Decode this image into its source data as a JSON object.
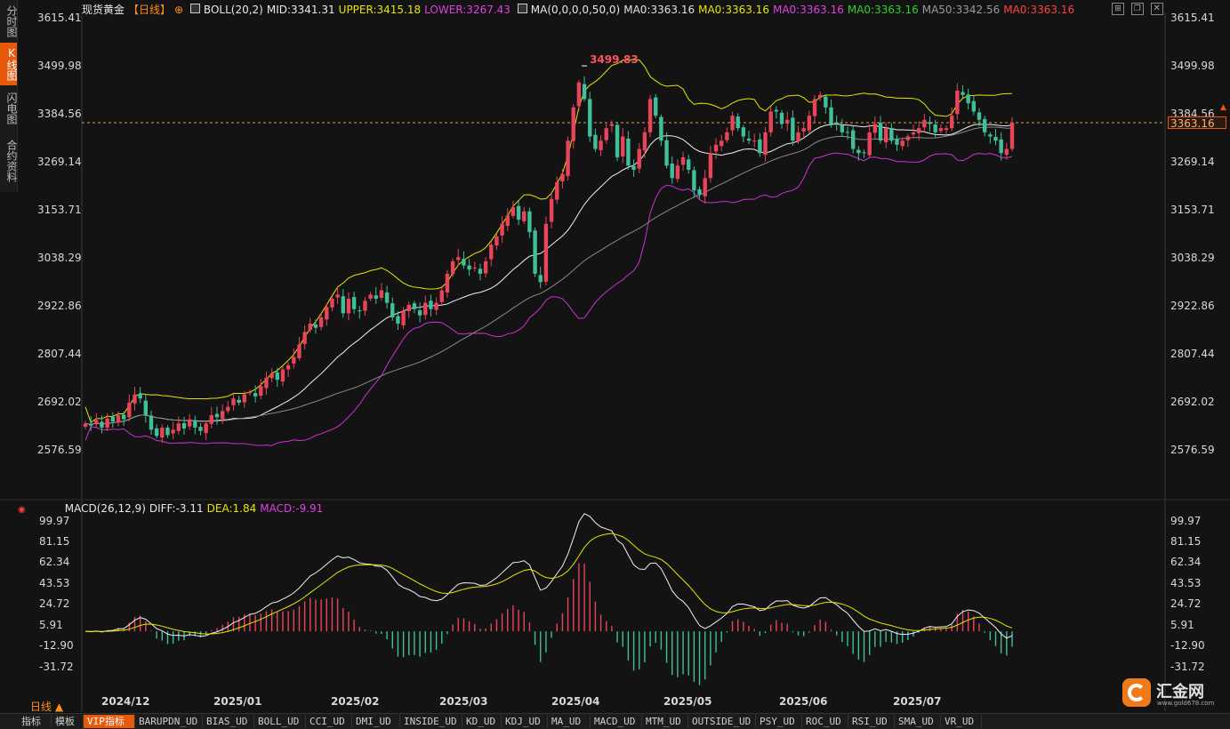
{
  "sidebar": {
    "tabs": [
      {
        "label": "分时图",
        "active": false
      },
      {
        "label": "K线图",
        "active": true
      },
      {
        "label": "闪电图",
        "active": false
      },
      {
        "label": "合约资料",
        "active": false
      }
    ]
  },
  "header": {
    "symbol": "现货黄金",
    "period": "【日线】",
    "boll": "BOLL(20,2)",
    "mid": "MID:3341.31",
    "upper": "UPPER:3415.18",
    "lower": "LOWER:3267.43",
    "ma_params": "MA(0,0,0,0,50,0)",
    "ma_values": [
      {
        "text": "MA0:3363.16",
        "color": "#e0e0e0"
      },
      {
        "text": "MA0:3363.16",
        "color": "#e6e600"
      },
      {
        "text": "MA0:3363.16",
        "color": "#e040e0"
      },
      {
        "text": "MA0:3363.16",
        "color": "#30d030"
      },
      {
        "text": "MA50:3342.56",
        "color": "#9a9a9a"
      },
      {
        "text": "MA0:3363.16",
        "color": "#ff4040"
      }
    ]
  },
  "price_axis": [
    "3615.41",
    "3499.98",
    "3384.56",
    "3269.14",
    "3153.71",
    "3038.29",
    "2922.86",
    "2807.44",
    "2692.02",
    "2576.59"
  ],
  "price_range": [
    2560,
    3615.41
  ],
  "current_price": "3363.16",
  "current_price_value": 3363.16,
  "high_label": "3499.83",
  "high_value": 3499.83,
  "macd": {
    "title": "MACD(26,12,9)",
    "diff": "DIFF:-3.11",
    "dea": "DEA:1.84",
    "macd": "MACD:-9.91",
    "axis": [
      "99.97",
      "81.15",
      "62.34",
      "43.53",
      "24.72",
      "5.91",
      "-12.90",
      "-31.72"
    ],
    "range": [
      -40,
      102
    ]
  },
  "x_axis": [
    "2024/12",
    "2025/01",
    "2025/02",
    "2025/03",
    "2025/04",
    "2025/05",
    "2025/06",
    "2025/07"
  ],
  "period_button": "日线 ▲",
  "bottom_tabs": [
    "指标",
    "模板",
    "VIP指标",
    "BARUPDN_UD",
    "BIAS_UD",
    "BOLL_UD",
    "CCI_UD",
    "DMI_UD",
    "INSIDE_UD",
    "KD_UD",
    "KDJ_UD",
    "MA_UD",
    "MACD_UD",
    "MTM_UD",
    "OUTSIDE_UD",
    "PSY_UD",
    "ROC_UD",
    "RSI_UD",
    "SMA_UD",
    "VR_UD"
  ],
  "logo": {
    "name": "汇金网",
    "url": "www.gold678.com"
  },
  "colors": {
    "up": "#e8455a",
    "down": "#3fbf9a",
    "boll_upper": "#e6e600",
    "boll_lower": "#d030d0",
    "mid": "#f0f0f0",
    "ma50": "#8a8a8a",
    "accent": "#e8590c"
  },
  "chart_data": {
    "type": "candlestick",
    "series_closes": [
      2640,
      2635,
      2648,
      2630,
      2652,
      2645,
      2660,
      2650,
      2690,
      2710,
      2700,
      2660,
      2625,
      2610,
      2630,
      2612,
      2625,
      2640,
      2628,
      2650,
      2630,
      2622,
      2640,
      2660,
      2655,
      2670,
      2680,
      2700,
      2690,
      2710,
      2715,
      2705,
      2730,
      2750,
      2760,
      2745,
      2770,
      2780,
      2800,
      2830,
      2860,
      2880,
      2870,
      2895,
      2920,
      2940,
      2950,
      2905,
      2940,
      2915,
      2910,
      2935,
      2950,
      2940,
      2960,
      2930,
      2895,
      2880,
      2910,
      2925,
      2915,
      2900,
      2930,
      2915,
      2930,
      2960,
      3000,
      3030,
      3040,
      3020,
      3010,
      3015,
      3000,
      3030,
      3070,
      3090,
      3120,
      3140,
      3160,
      3130,
      3150,
      3100,
      3000,
      2980,
      3120,
      3180,
      3220,
      3240,
      3320,
      3400,
      3460,
      3420,
      3330,
      3300,
      3320,
      3350,
      3360,
      3280,
      3330,
      3260,
      3250,
      3300,
      3340,
      3420,
      3380,
      3320,
      3260,
      3230,
      3260,
      3280,
      3250,
      3200,
      3190,
      3230,
      3290,
      3310,
      3320,
      3340,
      3380,
      3350,
      3330,
      3320,
      3320,
      3290,
      3340,
      3390,
      3390,
      3360,
      3370,
      3320,
      3340,
      3350,
      3380,
      3420,
      3430,
      3400,
      3360,
      3360,
      3340,
      3340,
      3300,
      3290,
      3290,
      3340,
      3360,
      3320,
      3350,
      3320,
      3310,
      3320,
      3330,
      3340,
      3350,
      3370,
      3360,
      3340,
      3350,
      3350,
      3380,
      3440,
      3430,
      3410,
      3390,
      3370,
      3340,
      3330,
      3320,
      3290,
      3300,
      3363.16
    ]
  }
}
